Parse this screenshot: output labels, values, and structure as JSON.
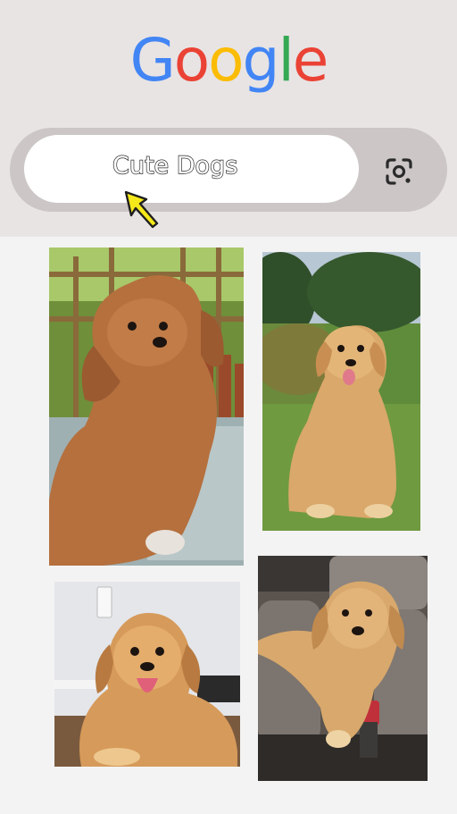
{
  "logo": {
    "text": "Google",
    "letter_colors": [
      "#4285F4",
      "#EA4335",
      "#FBBC05",
      "#4285F4",
      "#34A853",
      "#EA4335"
    ]
  },
  "search": {
    "query": "Cute Dogs",
    "lens_icon": "google-lens-icon"
  },
  "cursor": {
    "icon": "mouse-pointer-icon",
    "color": "#f5e81a"
  },
  "results": [
    {
      "icon": "dog-photo",
      "subject": "curly-poodle-mix-puppy"
    },
    {
      "icon": "dog-photo",
      "subject": "golden-retriever-puppy-on-grass"
    },
    {
      "icon": "dog-photo",
      "subject": "golden-retriever-puppy-lying-down"
    },
    {
      "icon": "dog-photo",
      "subject": "golden-retriever-puppy-in-car-seat"
    }
  ]
}
